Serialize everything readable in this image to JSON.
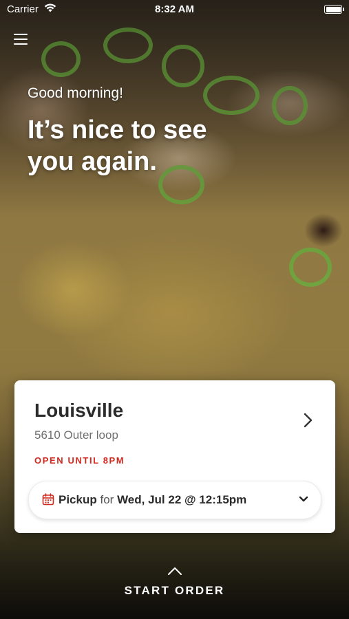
{
  "status_bar": {
    "carrier": "Carrier",
    "time": "8:32 AM",
    "wifi_icon": "wifi-icon",
    "battery_icon": "battery-icon"
  },
  "header": {
    "menu_icon": "hamburger-menu-icon"
  },
  "greeting": {
    "small": "Good morning!",
    "line1": "It’s nice to see",
    "line2": "you again."
  },
  "location_card": {
    "name": "Louisville",
    "address": "5610 Outer loop",
    "status": "OPEN UNTIL 8PM",
    "status_color": "#d0291f",
    "chevron_icon": "chevron-right-icon",
    "pickup": {
      "calendar_icon": "calendar-icon",
      "mode": "Pickup",
      "connector": "for",
      "datetime": "Wed, Jul 22 @ 12:15pm",
      "dropdown_icon": "chevron-down-icon"
    }
  },
  "footer": {
    "start_order_label": "START ORDER",
    "up_icon": "chevron-up-icon"
  }
}
